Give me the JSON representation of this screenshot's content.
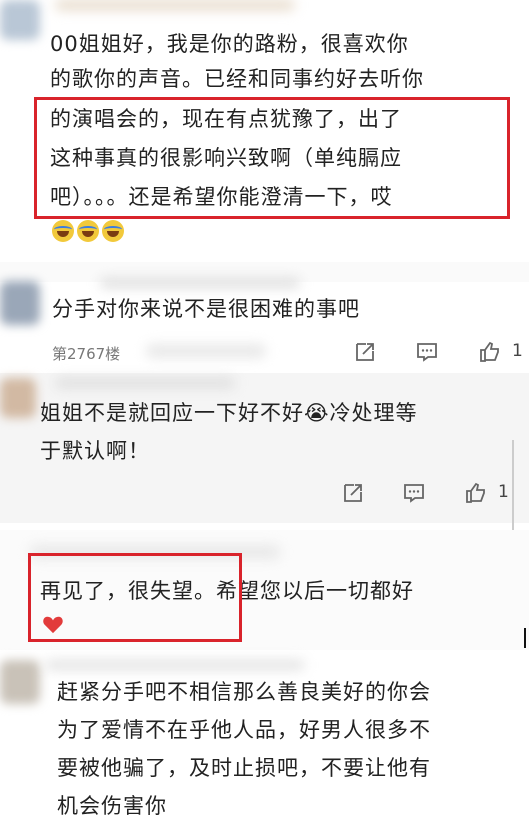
{
  "comments": [
    {
      "lines": [
        "00姐姐好，我是你的路粉，很喜欢你",
        "的歌你的声音。已经和同事约好去听你",
        "的演唱会的，现在有点犹豫了，出了",
        "这种事真的很影响兴致啊（单纯膈应",
        "吧）。。。还是希望你能澄清一下，哎"
      ],
      "emoji_label": "cry-laugh-emoji x3"
    },
    {
      "lines": [
        "分手对你来说不是很困难的事吧"
      ],
      "floor": "第2767楼",
      "like_count": "1"
    },
    {
      "lines": [
        "姐姐不是就回应一下好不好😭冷处理等",
        "于默认啊！"
      ],
      "like_count": "1"
    },
    {
      "lines": [
        "再见了，很失望。希望您以后一切都好"
      ]
    },
    {
      "lines": [
        "赶紧分手吧不相信那么善良美好的你会",
        "为了爱情不在乎他人品，好男人很多不",
        "要被他骗了，及时止损吧，不要让他有",
        "机会伤害你"
      ]
    }
  ],
  "icons": {
    "share": "share-icon",
    "comment": "comment-icon",
    "like": "thumbs-up-icon",
    "heart": "heart-icon"
  },
  "colors": {
    "highlight": "#d9232b",
    "band": "#f3f3f3"
  }
}
